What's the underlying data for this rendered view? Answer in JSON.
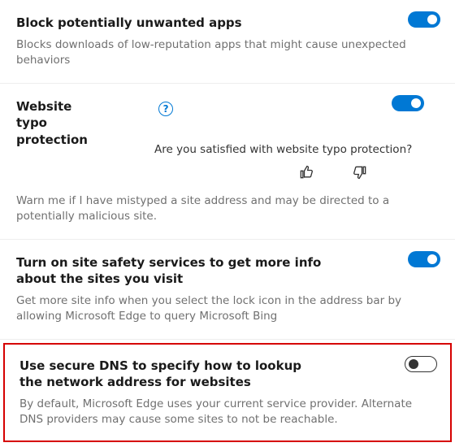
{
  "sections": {
    "block_apps": {
      "title": "Block potentially unwanted apps",
      "desc": "Blocks downloads of low-reputation apps that might cause unexpected behaviors",
      "toggle": "on"
    },
    "typo": {
      "title": "Website typo protection",
      "help_glyph": "?",
      "feedback_question": "Are you satisfied with website typo protection?",
      "desc": "Warn me if I have mistyped a site address and may be directed to a potentially malicious site.",
      "toggle": "on"
    },
    "site_safety": {
      "title": "Turn on site safety services to get more info about the sites you visit",
      "desc": "Get more site info when you select the lock icon in the address bar by allowing Microsoft Edge to query Microsoft Bing",
      "toggle": "on"
    },
    "secure_dns": {
      "title": "Use secure DNS to specify how to lookup the network address for websites",
      "desc": "By default, Microsoft Edge uses your current service provider. Alternate DNS providers may cause some sites to not be reachable.",
      "toggle": "off"
    }
  },
  "colors": {
    "accent": "#0078d4",
    "highlight_border": "#d60000"
  }
}
